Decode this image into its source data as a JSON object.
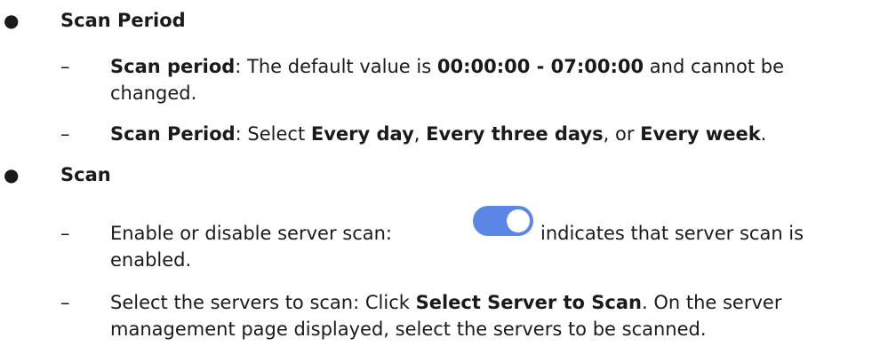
{
  "sections": [
    {
      "title": "Scan Period",
      "items": [
        {
          "term": "Scan period",
          "text_1": ": The default value is ",
          "value": "00:00:00 - 07:00:00",
          "text_2": " and cannot be",
          "text_3": "changed."
        },
        {
          "term": "Scan Period",
          "text_1": ": Select ",
          "opt_1": "Every day",
          "sep_1": ", ",
          "opt_2": "Every three days",
          "sep_2": ", or ",
          "opt_3": "Every week",
          "end": "."
        }
      ]
    },
    {
      "title": "Scan",
      "items": [
        {
          "text_1": "Enable or disable server scan: ",
          "text_2": "indicates that server scan is",
          "text_3": "enabled.",
          "toggle_icon": "toggle-on-icon",
          "toggle_color": "#5b86e5"
        },
        {
          "text_1": "Select the servers to scan: Click ",
          "action": "Select Server to Scan",
          "text_2": ". On the server",
          "text_3": "management page displayed, select the servers to be scanned."
        }
      ]
    }
  ],
  "bullet_glyph": "●",
  "dash_glyph": "–"
}
